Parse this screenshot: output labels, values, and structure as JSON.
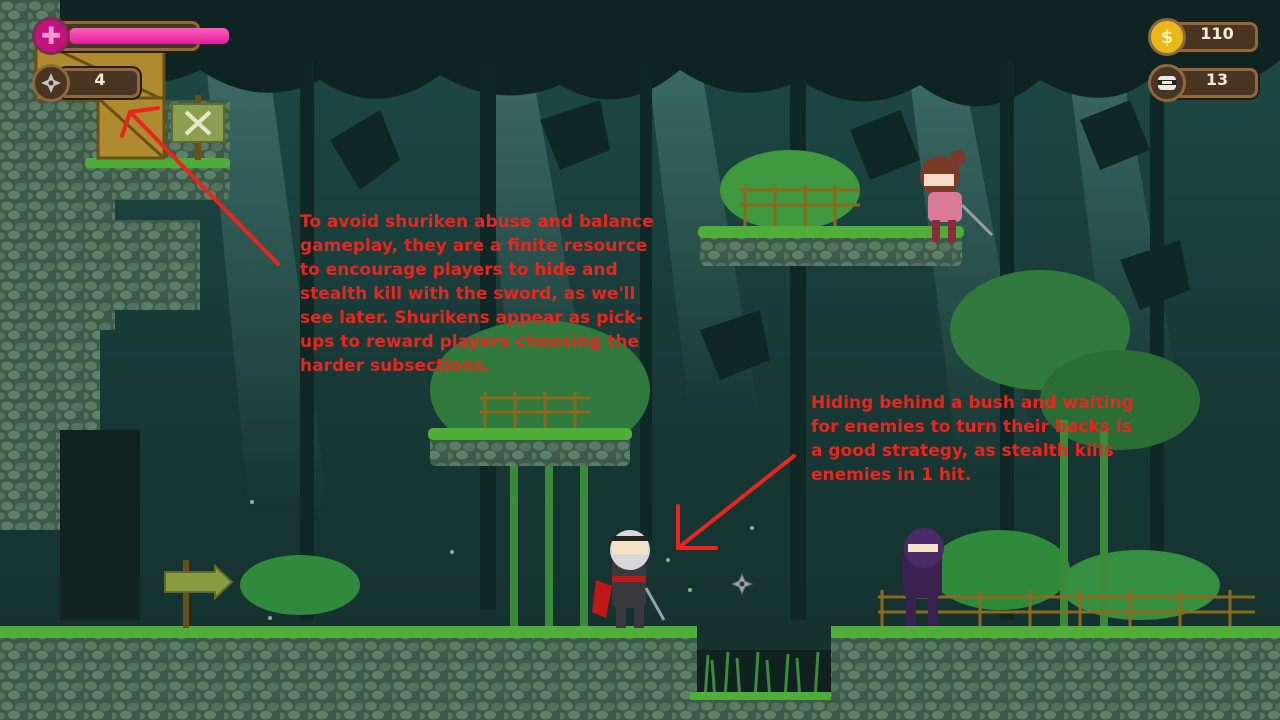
{
  "hud": {
    "health_icon": "plus-icon",
    "shuriken_icon": "shuriken-icon",
    "shuriken_count": "4",
    "coin_icon": "coin-icon",
    "coin_symbol": "$",
    "coin_count": "110",
    "kills_icon": "ninja-head-icon",
    "kills_count": "13"
  },
  "annotations": {
    "shuriken_note": "To avoid shuriken abuse and balance gameplay, they are a finite resource to encourage players to hide and stealth kill with the sword, as we'll see later. Shurikens appear as pick-ups to reward players choosing the harder subsections.",
    "stealth_note": "Hiding behind a bush and waiting for enemies to turn their backs is a good strategy, as stealth kills enemies in 1 hit."
  },
  "colors": {
    "annotation": "#e8261e",
    "health": "#e0209a",
    "coin": "#e8b81c",
    "hud_frame": "#4a3422",
    "grass": "#4fae3a",
    "stone": "#4d6b56"
  },
  "status": {
    "health_fraction": 1.0
  }
}
